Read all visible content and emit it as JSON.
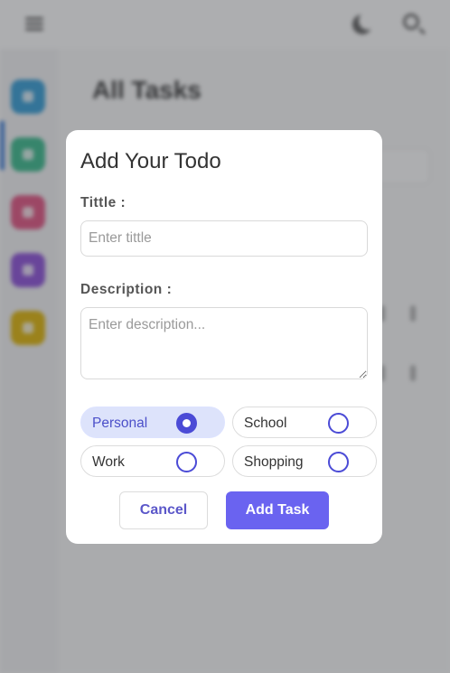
{
  "background": {
    "page_title": "All Tasks",
    "icons": [
      "menu-icon",
      "moon-icon",
      "search-icon"
    ],
    "sidebar_colors": [
      "#2f9bd6",
      "#34b98a",
      "#e24f7f",
      "#8a4bd9",
      "#e0b400"
    ]
  },
  "modal": {
    "title": "Add Your Todo",
    "title_field": {
      "label": "Tittle :",
      "value": "",
      "placeholder": "Enter tittle"
    },
    "description_field": {
      "label": "Description :",
      "value": "",
      "placeholder": "Enter description..."
    },
    "categories": [
      {
        "label": "Personal",
        "selected": true
      },
      {
        "label": "School",
        "selected": false
      },
      {
        "label": "Work",
        "selected": false
      },
      {
        "label": "Shopping",
        "selected": false
      }
    ],
    "cancel_label": "Cancel",
    "add_label": "Add Task"
  },
  "colors": {
    "accent": "#6a63f0",
    "radio": "#4b4bd6",
    "selected_chip_bg": "#dde3fb"
  }
}
